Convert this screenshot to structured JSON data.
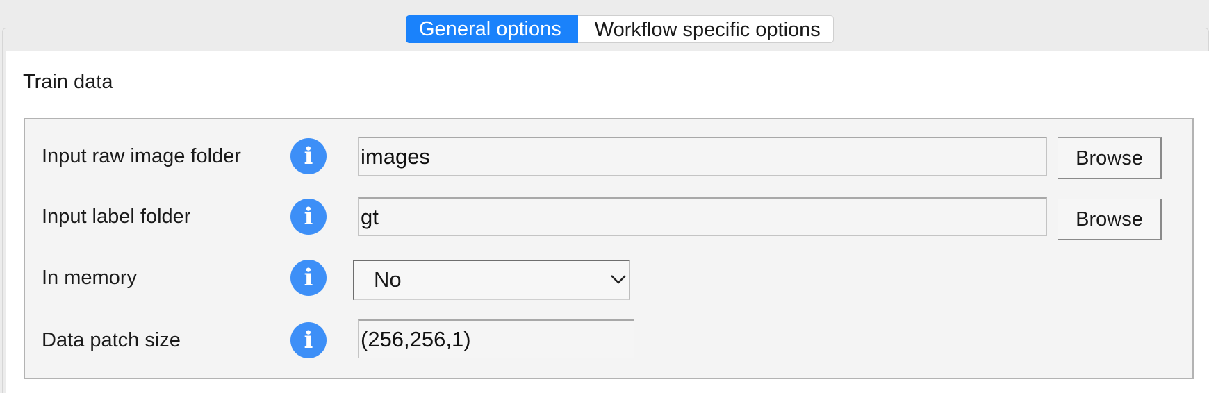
{
  "tabs": [
    {
      "label": "General options",
      "active": true
    },
    {
      "label": "Workflow specific options",
      "active": false
    }
  ],
  "section": {
    "title": "Train data"
  },
  "fields": {
    "raw_image_folder": {
      "label": "Input raw image folder",
      "value": "images",
      "button_label": "Browse",
      "info_icon": "info-icon"
    },
    "label_folder": {
      "label": "Input label folder",
      "value": "gt",
      "button_label": "Browse",
      "info_icon": "info-icon"
    },
    "in_memory": {
      "label": "In memory",
      "selected": "No",
      "info_icon": "info-icon"
    },
    "patch_size": {
      "label": "Data patch size",
      "value": "(256,256,1)",
      "info_icon": "info-icon"
    }
  },
  "colors": {
    "accent": "#1a82fb",
    "info_icon": "#3d8ff7"
  }
}
